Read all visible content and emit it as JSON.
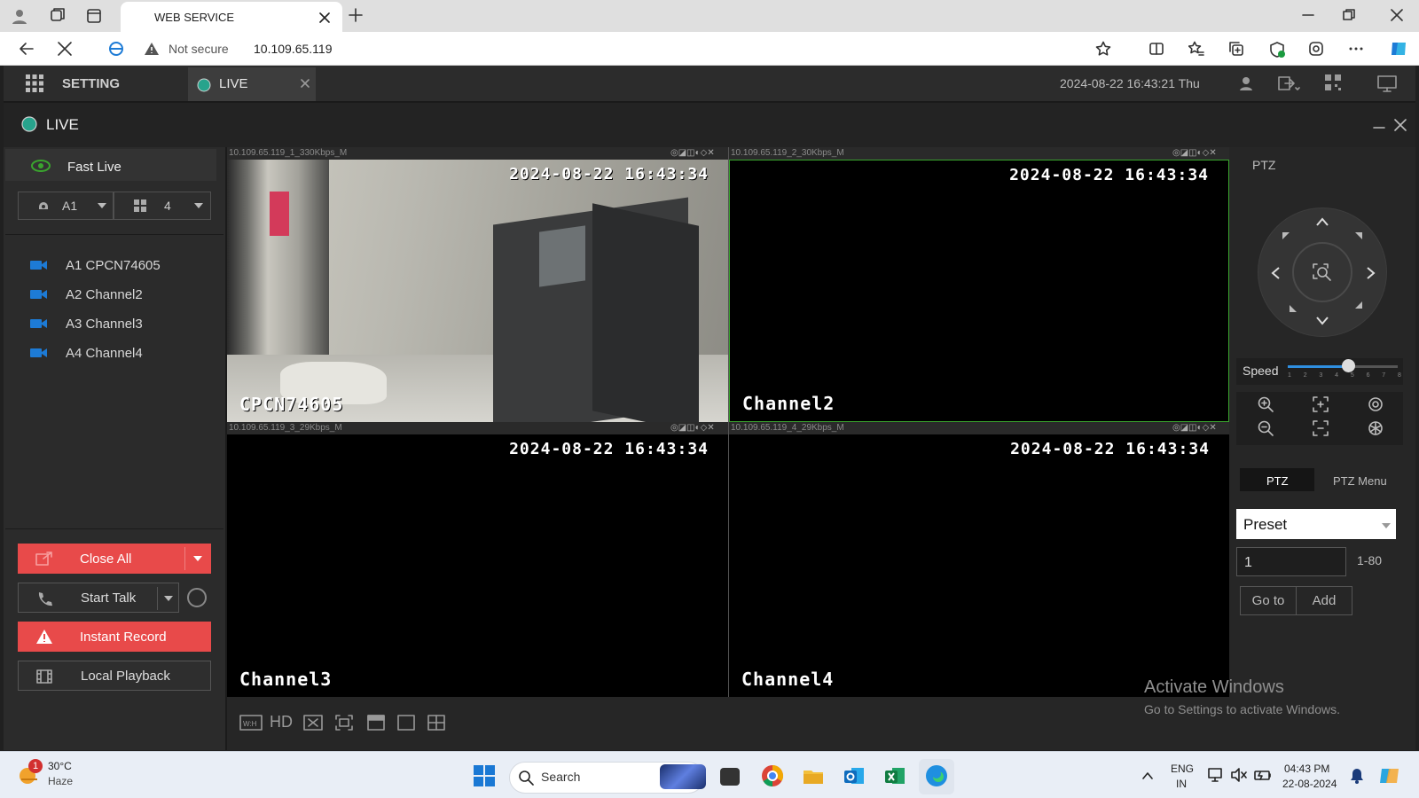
{
  "browser": {
    "tab_title": "WEB SERVICE",
    "security_label": "Not secure",
    "url": "10.109.65.119"
  },
  "app": {
    "setting_label": "SETTING",
    "live_tab_label": "LIVE",
    "datetime": "2024-08-22 16:43:21 Thu",
    "panel_title": "LIVE"
  },
  "left": {
    "fast_live_label": "Fast Live",
    "stream_select": "A1",
    "layout_select": "4",
    "channels": [
      {
        "label": "A1 CPCN74605"
      },
      {
        "label": "A2 Channel2"
      },
      {
        "label": "A3 Channel3"
      },
      {
        "label": "A4 Channel4"
      }
    ],
    "close_all_label": "Close All",
    "start_talk_label": "Start Talk",
    "instant_record_label": "Instant Record",
    "local_playback_label": "Local Playback"
  },
  "videos": [
    {
      "title": "10.109.65.119_1_330Kbps_M",
      "timestamp": "2024-08-22 16:43:34",
      "name": "CPCN74605"
    },
    {
      "title": "10.109.65.119_2_30Kbps_M",
      "timestamp": "2024-08-22 16:43:34",
      "name": "Channel2"
    },
    {
      "title": "10.109.65.119_3_29Kbps_M",
      "timestamp": "2024-08-22 16:43:34",
      "name": "Channel3"
    },
    {
      "title": "10.109.65.119_4_29Kbps_M",
      "timestamp": "2024-08-22 16:43:34",
      "name": "Channel4"
    }
  ],
  "toolbar": {
    "hd_label": "HD"
  },
  "ptz": {
    "title": "PTZ",
    "speed_label": "Speed",
    "speed_ticks": [
      "1",
      "2",
      "3",
      "4",
      "5",
      "6",
      "7",
      "8"
    ],
    "speed_value_fraction": 0.55,
    "tab_ptz": "PTZ",
    "tab_ptz_menu": "PTZ Menu",
    "preset_select": "Preset",
    "preset_number": "1",
    "preset_range": "1-80",
    "goto_label": "Go to",
    "add_label": "Add"
  },
  "watermark": {
    "line1": "Activate Windows",
    "line2": "Go to Settings to activate Windows."
  },
  "taskbar": {
    "weather_temp": "30°C",
    "weather_desc": "Haze",
    "weather_badge": "1",
    "search_label": "Search",
    "lang_line1": "ENG",
    "lang_line2": "IN",
    "time": "04:43 PM",
    "date": "22-08-2024"
  },
  "colors": {
    "accent_red": "#e84a4a",
    "selected_border": "#3aa52e",
    "channel_icon": "#1d7bd6"
  }
}
